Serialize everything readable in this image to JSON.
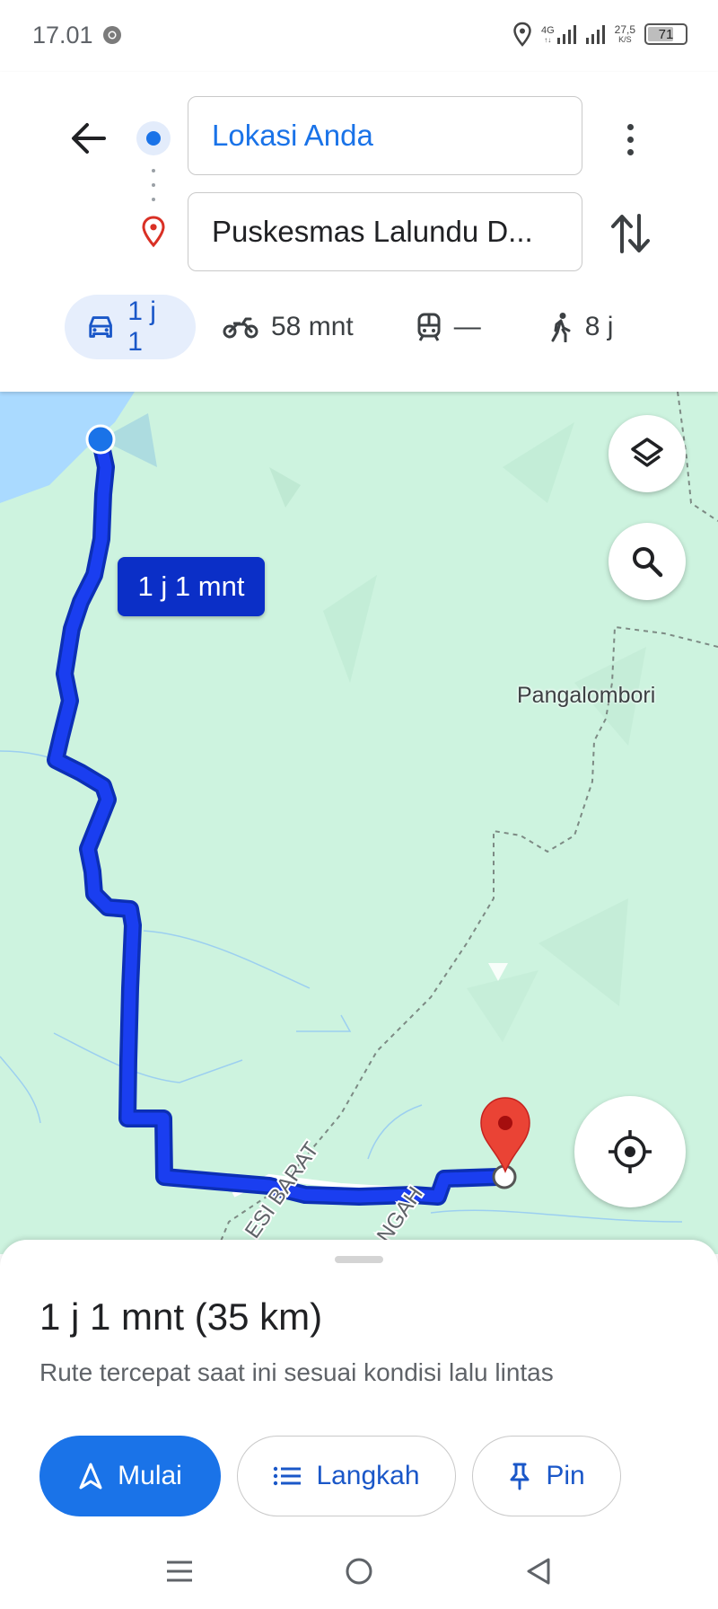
{
  "status_bar": {
    "time": "17.01",
    "network": "4G",
    "network_sub": "↑↓",
    "speed_value": "27,5",
    "speed_unit": "K/S",
    "battery": "71",
    "battery_level": 0.71
  },
  "directions": {
    "origin": "Lokasi Anda",
    "destination": "Puskesmas Lalundu D..."
  },
  "modes": [
    {
      "name": "car",
      "label": "1 j 1",
      "selected": true
    },
    {
      "name": "motorcycle",
      "label": "58 mnt",
      "selected": false
    },
    {
      "name": "transit",
      "label": "—",
      "selected": false
    },
    {
      "name": "walk",
      "label": "8 j",
      "selected": false
    }
  ],
  "map": {
    "eta_bubble": "1 j 1 mnt",
    "place_label": "Pangalombori",
    "road_label_1": "ESI BARAT",
    "road_label_2": "NGAH",
    "colors": {
      "land": "#cdf3df",
      "water": "#aadaff",
      "route": "#1a3ef0",
      "pin": "#ea4335"
    }
  },
  "sheet": {
    "summary": "1 j 1 mnt (35 km)",
    "note": "Rute tercepat saat ini sesuai kondisi lalu lintas",
    "start_label": "Mulai",
    "steps_label": "Langkah",
    "pin_label": "Pin"
  },
  "accent": "#1a73e8"
}
